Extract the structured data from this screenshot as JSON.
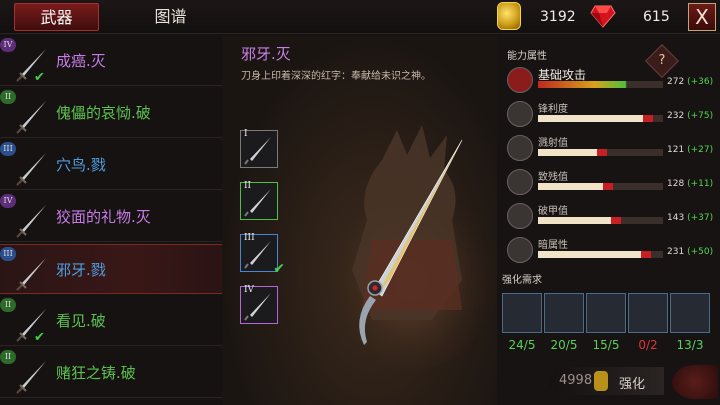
{
  "tabs": {
    "weapons": "武器",
    "codex": "图谱"
  },
  "currency": {
    "gold": "3192",
    "gems": "615",
    "close_label": "X"
  },
  "weapon_list": [
    {
      "rank": "IV",
      "name": "成癌.灭",
      "color": "#c77ce6",
      "checked": true
    },
    {
      "rank": "II",
      "name": "傀儡的哀恸.破",
      "color": "#5cc24f",
      "checked": false
    },
    {
      "rank": "III",
      "name": "穴鸟.戮",
      "color": "#4f9ee0",
      "checked": false
    },
    {
      "rank": "IV",
      "name": "狡面的礼物.灭",
      "color": "#c77ce6",
      "checked": false
    },
    {
      "rank": "III",
      "name": "邪牙.戮",
      "color": "#4f9ee0",
      "checked": false,
      "selected": true
    },
    {
      "rank": "II",
      "name": "看见.破",
      "color": "#5cc24f",
      "checked": true
    },
    {
      "rank": "II",
      "name": "赌狂之铸.破",
      "color": "#5cc24f",
      "checked": false
    }
  ],
  "detail": {
    "title": "邪牙.灭",
    "description": "刀身上印着深深的红字：奉献给未识之神。",
    "slots": [
      {
        "rank": "I",
        "border": "#7a7a7a"
      },
      {
        "rank": "II",
        "border": "#4fbf46"
      },
      {
        "rank": "III",
        "border": "#4a86d0",
        "checked": true
      },
      {
        "rank": "IV",
        "border": "#b566d8"
      }
    ]
  },
  "stats_panel": {
    "title": "能力属性",
    "help": "?",
    "stats": [
      {
        "name": "基础攻击",
        "value": "272",
        "bonus": "(+36)",
        "icon": "attack-icon",
        "fill": 0.85
      },
      {
        "name": "锋利度",
        "value": "232",
        "bonus": "(+75)",
        "icon": "sharpness-icon",
        "fill": 0.92
      },
      {
        "name": "溅射值",
        "value": "121",
        "bonus": "(+27)",
        "icon": "splash-icon",
        "fill": 0.55
      },
      {
        "name": "致残值",
        "value": "128",
        "bonus": "(+11)",
        "icon": "cripple-icon",
        "fill": 0.6
      },
      {
        "name": "破甲值",
        "value": "143",
        "bonus": "(+37)",
        "icon": "armor-break-icon",
        "fill": 0.66
      },
      {
        "name": "暗属性",
        "value": "231",
        "bonus": "(+50)",
        "icon": "dark-element-icon",
        "fill": 0.9
      }
    ]
  },
  "upgrade": {
    "title": "强化需求",
    "materials": [
      {
        "icon": "hammer-icon",
        "count": "24/5",
        "color": "#5cd05a"
      },
      {
        "icon": "ore-icon",
        "count": "20/5",
        "color": "#5cd05a"
      },
      {
        "icon": "mechanism-icon",
        "count": "15/5",
        "color": "#5cd05a"
      },
      {
        "icon": "dark-crystal-icon",
        "count": "0/2",
        "color": "#e03535"
      },
      {
        "icon": "feather-icon",
        "count": "13/3",
        "color": "#5cd05a"
      }
    ],
    "cost": "4998",
    "button_label": "强化"
  }
}
